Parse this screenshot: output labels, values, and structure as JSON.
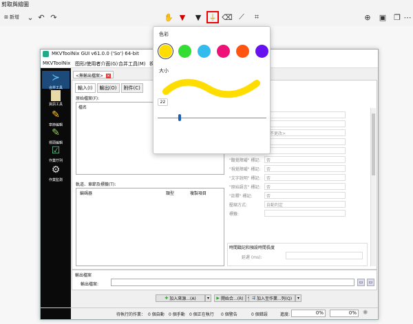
{
  "app": {
    "title": "剪取與繪圖",
    "new_label": "新增"
  },
  "mkv": {
    "title": "MKVToolNix GUI v61.0.0 ('So') 64-bit",
    "menu": [
      "MKVToolNix",
      "图形/使用者介面(G)",
      "合并工具(M)",
      "視窗"
    ],
    "doc_tab": "<無輸出檔案>",
    "sub_tabs": [
      "輸入(I)",
      "輸出(O)",
      "附件(C)"
    ],
    "source_files_label": "原始檔案(F):",
    "col_name": "檔名",
    "tracks_label": "軌道、章節及標籤(T):",
    "track_cols": [
      "編碼器",
      "類型",
      "複製項目"
    ],
    "props": [
      {
        "label": "",
        "value": "是"
      },
      {
        "label": "軌道名稱(N):",
        "value": ""
      },
      {
        "label": "語言(L):",
        "value": "<不更改>"
      },
      {
        "label": "\"預設軌\" 標記:",
        "value": "是"
      },
      {
        "label": "\"強制顯示\" 標記:",
        "value": "否"
      },
      {
        "label": "\"聽覺障礙\" 標記:",
        "value": "否"
      },
      {
        "label": "\"視覺障礙\" 標記:",
        "value": "否"
      },
      {
        "label": "\"文字說明\" 標記:",
        "value": "否"
      },
      {
        "label": "\"原始語言\" 標記:",
        "value": "否"
      },
      {
        "label": "\"註釋\" 標記:",
        "value": "否"
      },
      {
        "label": "壓縮方式:",
        "value": "自動判定"
      },
      {
        "label": "標籤:",
        "value": ""
      }
    ],
    "timing_section": "時間戳記和預設時間長度",
    "delay_label": "延遲 (ms):",
    "output_section": "輸出檔案",
    "output_file_label": "輸出檔案:",
    "add_source_btn": "加入來源...(A)",
    "start_mux_btn": "開始合...(R)",
    "add_job_btn": "加入至作業...列(Q)",
    "status_jobs": "待執行的作業：",
    "status_auto": "0 個自動",
    "status_manual": "0 個手動",
    "status_running": "0 個正在執行",
    "status_warnings": "0 個警告",
    "status_errors": "0 個錯誤",
    "status_progress_label": "進度:",
    "status_pct1": "0%",
    "status_pct2": "0%",
    "side": [
      "合并工具",
      "資訊工具",
      "章節編輯",
      "標頭編輯",
      "作業佇列",
      "作業監測"
    ]
  },
  "popup": {
    "color_label": "色彩",
    "size_label": "大小",
    "size_value": "22",
    "colors": [
      "#ffdd00",
      "#33dd33",
      "#33bbee",
      "#ee1177",
      "#ff5511",
      "#6611ee"
    ],
    "selected_color": "#ffdd00"
  }
}
